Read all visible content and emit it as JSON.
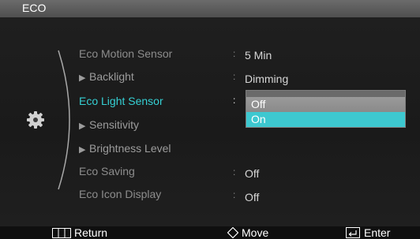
{
  "window": {
    "title": "ECO"
  },
  "menu": {
    "items": [
      {
        "label": "Eco Motion Sensor",
        "value": "5 Min",
        "style": "normal"
      },
      {
        "label": "Backlight",
        "value": "Dimming",
        "style": "sub"
      },
      {
        "label": "Eco Light Sensor",
        "value": "",
        "style": "active"
      },
      {
        "label": "Sensitivity",
        "value": "",
        "style": "sub"
      },
      {
        "label": "Brightness Level",
        "value": "",
        "style": "sub"
      },
      {
        "label": "Eco Saving",
        "value": "Off",
        "style": "normal"
      },
      {
        "label": "Eco Icon Display",
        "value": "Off",
        "style": "normal"
      }
    ],
    "separator": ":"
  },
  "dropdown": {
    "options": [
      "Off",
      "On"
    ],
    "selected": "On"
  },
  "footer": {
    "return_label": "Return",
    "move_label": "Move",
    "enter_label": "Enter"
  },
  "colors": {
    "accent": "#35d0d4",
    "highlight": "#3dc8d0",
    "background": "#1c1c1c",
    "title_bar": "#5c5c5c"
  },
  "icons": {
    "category": "gear-icon",
    "return": "menu-icon",
    "move": "diamond-navigation-icon",
    "enter": "enter-icon"
  }
}
